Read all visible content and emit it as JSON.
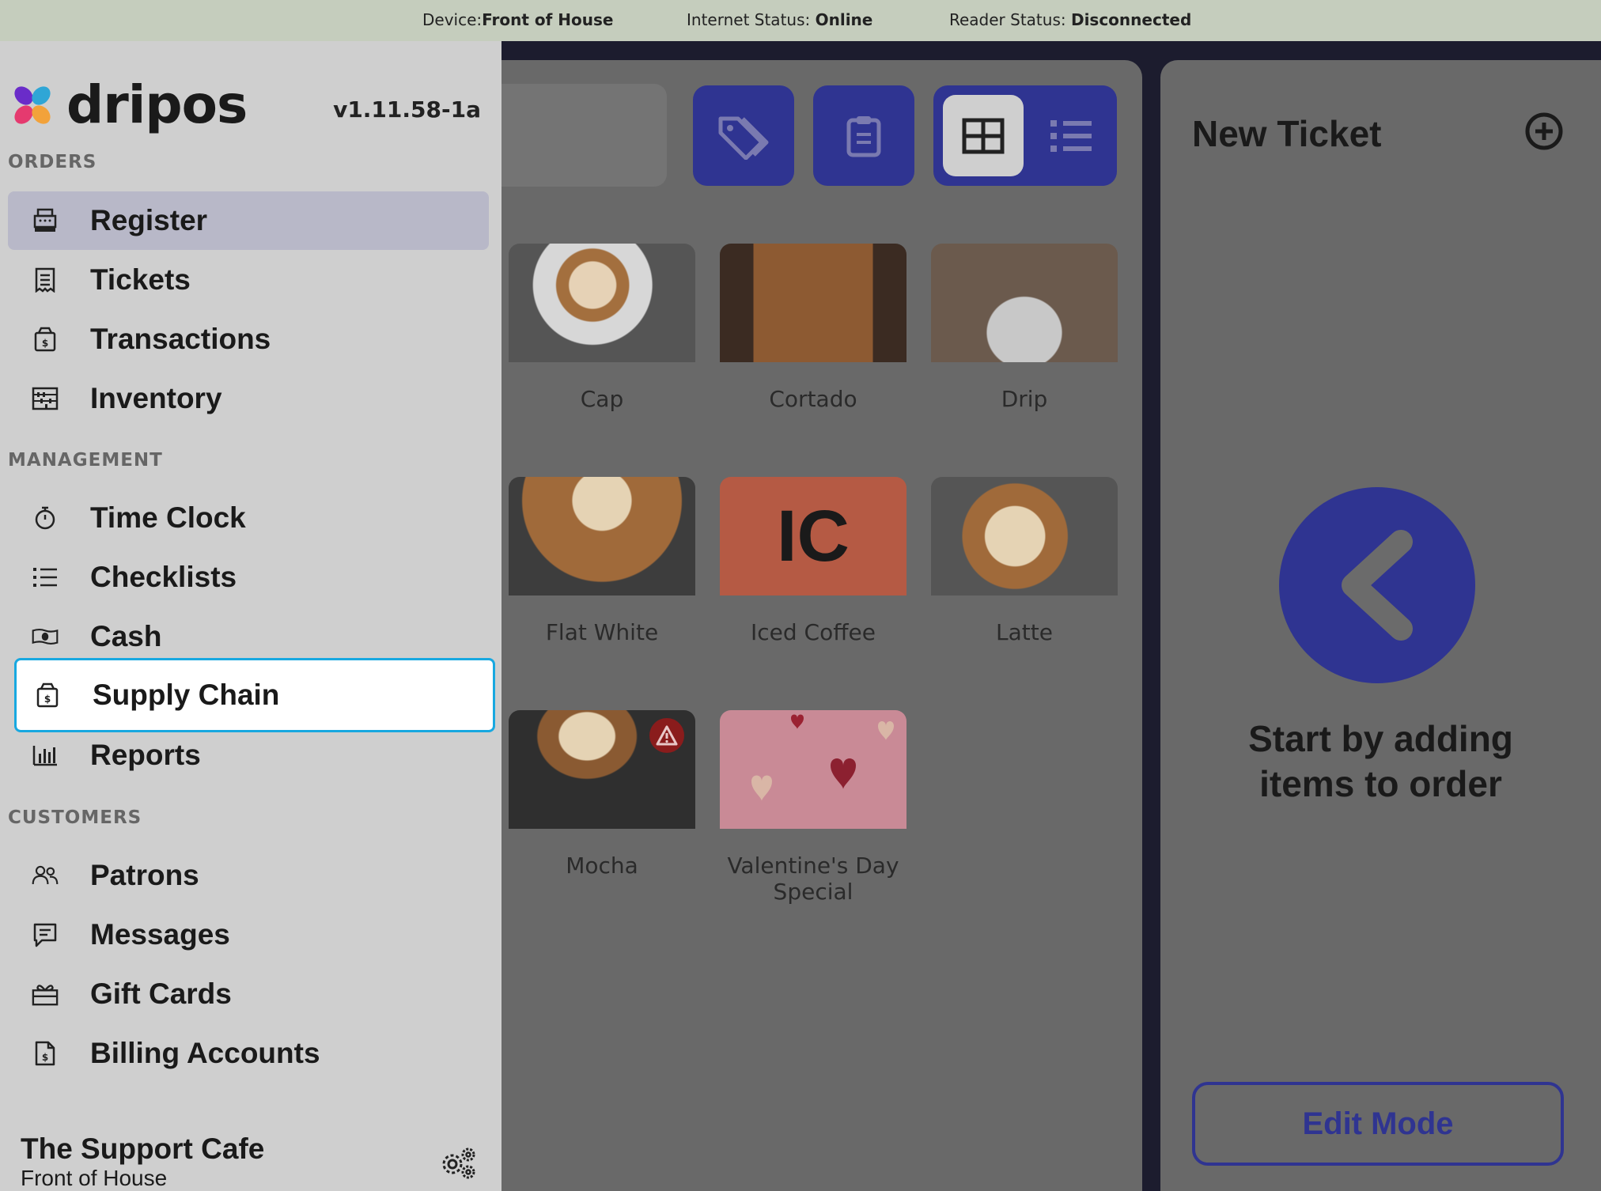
{
  "statusbar": {
    "device_label": "Device:",
    "device_value": "Front of House",
    "internet_label": "Internet Status: ",
    "internet_value": "Online",
    "reader_label": "Reader Status: ",
    "reader_value": "Disconnected"
  },
  "sidebar": {
    "logo_text": "dripos",
    "version": "v1.11.58-1a",
    "sections": {
      "orders": "ORDERS",
      "management": "MANAGEMENT",
      "customers": "CUSTOMERS"
    },
    "items": [
      {
        "label": "Register",
        "icon": "cash-register-icon"
      },
      {
        "label": "Tickets",
        "icon": "receipt-icon"
      },
      {
        "label": "Transactions",
        "icon": "money-box-icon"
      },
      {
        "label": "Inventory",
        "icon": "abacus-icon"
      },
      {
        "label": "Time Clock",
        "icon": "stopwatch-icon"
      },
      {
        "label": "Checklists",
        "icon": "list-icon"
      },
      {
        "label": "Cash",
        "icon": "banknote-icon"
      },
      {
        "label": "Supply Chain",
        "icon": "supply-box-icon"
      },
      {
        "label": "Reports",
        "icon": "bar-chart-icon"
      },
      {
        "label": "Patrons",
        "icon": "users-icon"
      },
      {
        "label": "Messages",
        "icon": "message-icon"
      },
      {
        "label": "Gift Cards",
        "icon": "gift-icon"
      },
      {
        "label": "Billing Accounts",
        "icon": "invoice-icon"
      }
    ],
    "store_name": "The Support Cafe",
    "store_device": "Front of House"
  },
  "products": [
    {
      "name": "Cap"
    },
    {
      "name": "Cortado"
    },
    {
      "name": "Drip"
    },
    {
      "name": "Flat White"
    },
    {
      "name": "Iced Coffee",
      "initials": "IC"
    },
    {
      "name": "Latte"
    },
    {
      "name": "Mocha"
    },
    {
      "name": "Valentine's Day Special"
    }
  ],
  "ticket": {
    "title": "New Ticket",
    "empty_message": "Start by adding items to order",
    "edit_mode": "Edit Mode"
  },
  "colors": {
    "accent": "#2f3491",
    "focus": "#18a8e0",
    "iced_coffee_tile": "#b55a44"
  }
}
